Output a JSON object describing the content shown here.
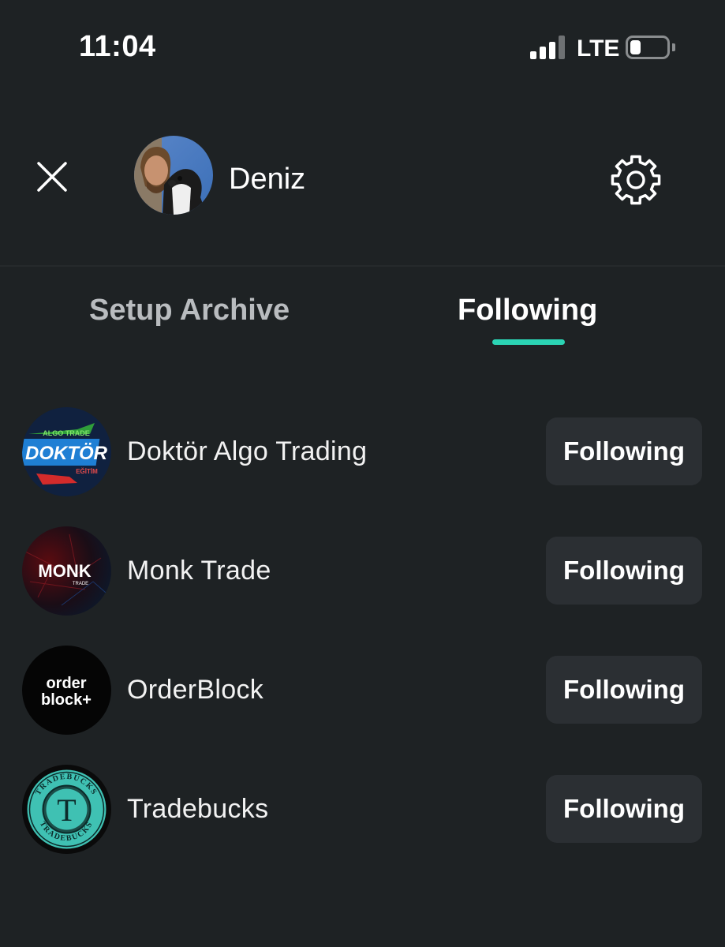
{
  "status_bar": {
    "time": "11:04",
    "network": "LTE",
    "battery_level": 0.3
  },
  "header": {
    "close_icon": "close-icon",
    "username": "Deniz",
    "settings_icon": "gear-icon"
  },
  "tabs": [
    {
      "label": "Setup Archive",
      "active": false
    },
    {
      "label": "Following",
      "active": true
    }
  ],
  "colors": {
    "background": "#1e2224",
    "accent": "#2bd4b4",
    "button_bg": "#2b2f33",
    "inactive_tab": "#b9bcbf"
  },
  "following": [
    {
      "name": "Doktör Algo Trading",
      "button": "Following",
      "logo": {
        "top": "ALGO TRADE",
        "main": "DOKTÖR",
        "bottom": "EĞİTİM"
      }
    },
    {
      "name": "Monk Trade",
      "button": "Following",
      "logo": {
        "main": "MONK",
        "sub": "TRADE"
      }
    },
    {
      "name": "OrderBlock",
      "button": "Following",
      "logo": {
        "line1": "order",
        "line2": "block+"
      }
    },
    {
      "name": "Tradebucks",
      "button": "Following",
      "logo": {
        "ring_text": "TRADEBUCKS",
        "letter": "T"
      }
    }
  ]
}
